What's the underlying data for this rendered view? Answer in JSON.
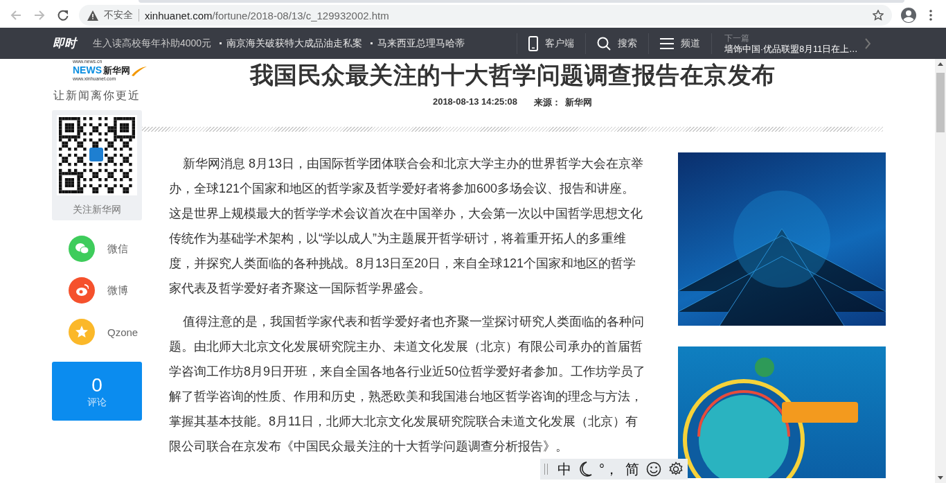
{
  "browser": {
    "security_label": "不安全",
    "url_host": "xinhuanet.com",
    "url_path": "/fortune/2018-08/13/c_129932002.htm"
  },
  "nav": {
    "logo": "即时",
    "ticker": [
      "生入读高校每年补助4000元",
      "南京海关破获特大成品油走私案",
      "马来西亚总理马哈蒂"
    ],
    "links": [
      {
        "kind": "phone",
        "label": "客户端"
      },
      {
        "kind": "search",
        "label": "搜索"
      },
      {
        "kind": "menu",
        "label": "频道"
      }
    ],
    "next": {
      "label": "下一篇",
      "title": "墙饰中国·优品联盟8月11日在上…"
    }
  },
  "sidebar": {
    "logo": {
      "top_url": "www.news.cn",
      "site": "新华网",
      "mark": "NEWS",
      "url": "www.xinhuanet.com"
    },
    "slogan": "让新闻离你更近",
    "qr_caption": "关注新华网",
    "share": [
      {
        "kind": "wechat",
        "label": "微信",
        "color": "#3ecc5b"
      },
      {
        "kind": "weibo",
        "label": "微博",
        "color": "#f5512c"
      },
      {
        "kind": "qzone",
        "label": "Qzone",
        "color": "#fbb829"
      }
    ],
    "comments": {
      "count": "0",
      "label": "评论"
    }
  },
  "article": {
    "title": "我国民众最关注的十大哲学问题调查报告在京发布",
    "date": "2018-08-13 14:25:08",
    "source_label": "来源：",
    "source": "新华网",
    "paragraphs": [
      "新华网消息 8月13日，由国际哲学团体联合会和北京大学主办的世界哲学大会在京举办，全球121个国家和地区的哲学家及哲学爱好者将参加600多场会议、报告和讲座。这是世界上规模最大的哲学学术会议首次在中国举办，大会第一次以中国哲学思想文化传统作为基础学术架构，以“学以成人”为主题展开哲学研讨，将着重开拓人的多重维度，并探究人类面临的各种挑战。8月13日至20日，来自全球121个国家和地区的哲学家代表及哲学爱好者齐聚这一国际哲学界盛会。",
      "值得注意的是，我国哲学家代表和哲学爱好者也齐聚一堂探讨研究人类面临的各种问题。由北师大北京文化发展研究院主办、未道文化发展（北京）有限公司承办的首届哲学咨询工作坊8月9日开班，来自全国各地各行业近50位哲学爱好者参加。工作坊学员了解了哲学咨询的性质、作用和历史，熟悉欧美和我国港台地区哲学咨询的理念与方法，掌握其基本技能。8月11日，北师大北京文化发展研究院联合未道文化发展（北京）有限公司联合在京发布《中国民众最关注的十大哲学问题调查分析报告》。"
    ]
  },
  "ime": {
    "items": [
      {
        "kind": "text",
        "label": "中"
      },
      {
        "kind": "moon"
      },
      {
        "kind": "text",
        "label": "°，"
      },
      {
        "kind": "text",
        "label": "简"
      },
      {
        "kind": "smiley"
      },
      {
        "kind": "gear"
      }
    ]
  }
}
